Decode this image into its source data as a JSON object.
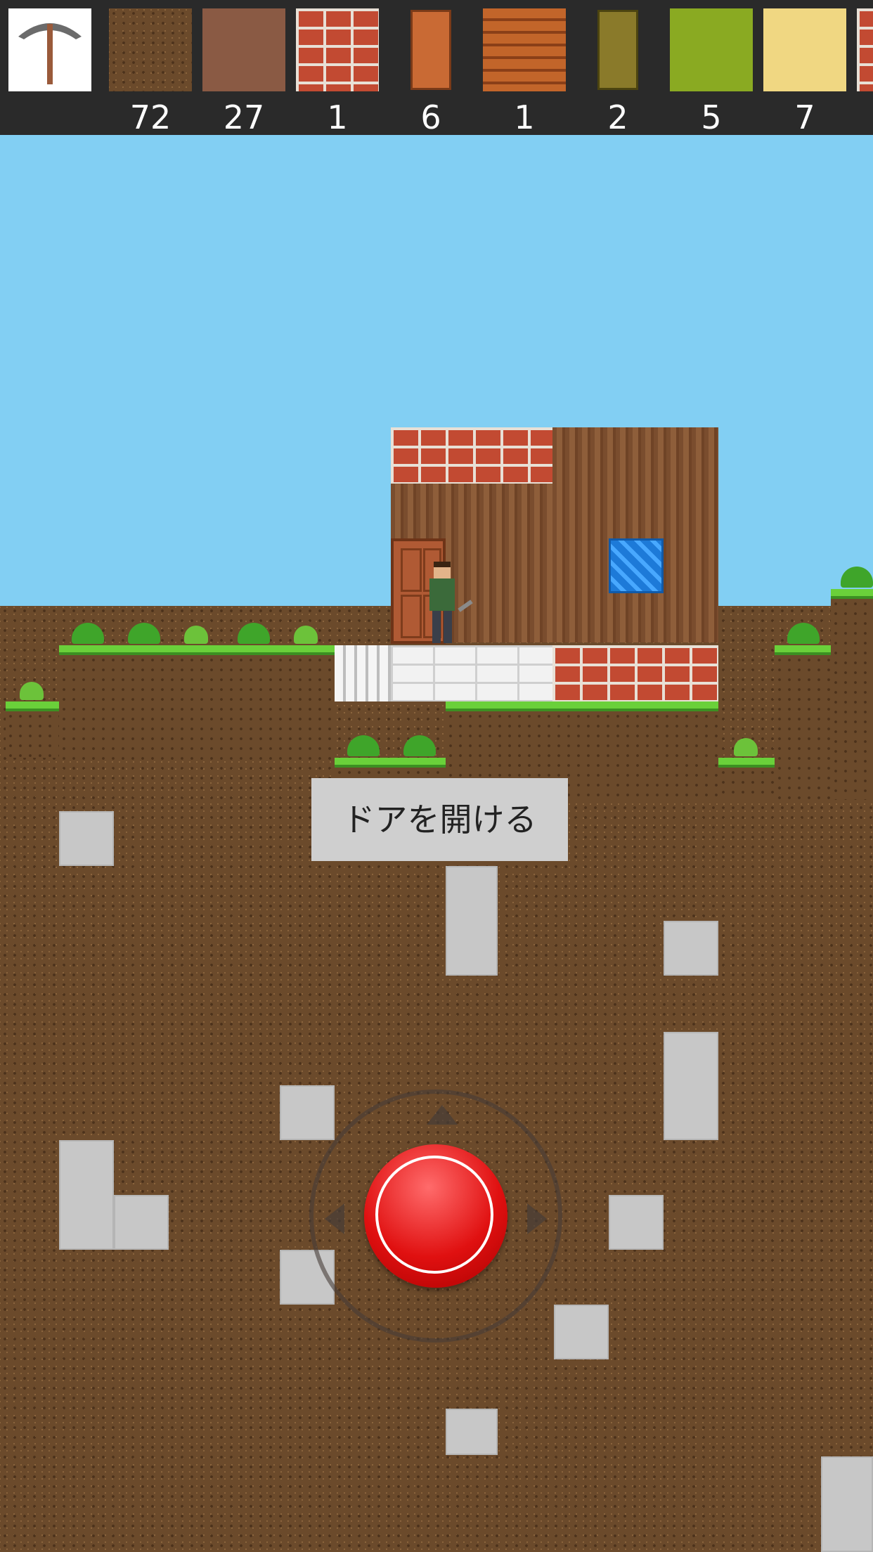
{
  "hotbar": {
    "slots": [
      {
        "icon": "pickaxe-icon",
        "count": ""
      },
      {
        "icon": "dirt-block-icon",
        "count": "72"
      },
      {
        "icon": "clay-block-icon",
        "count": "27"
      },
      {
        "icon": "brick-block-icon",
        "count": "1"
      },
      {
        "icon": "wooden-door-icon",
        "count": "6"
      },
      {
        "icon": "log-block-icon",
        "count": "1"
      },
      {
        "icon": "green-door-icon",
        "count": "2"
      },
      {
        "icon": "mossy-block-icon",
        "count": "5"
      },
      {
        "icon": "sand-block-icon",
        "count": "7"
      },
      {
        "icon": "brick-block-partial-icon",
        "count": ""
      }
    ]
  },
  "popup": {
    "label": "ドアを開ける"
  },
  "colors": {
    "sky": "#82cff3",
    "dirt": "#6b4a2b",
    "grass": "#6ad03a",
    "stone": "#c7c7c7",
    "button": "#e01010"
  }
}
